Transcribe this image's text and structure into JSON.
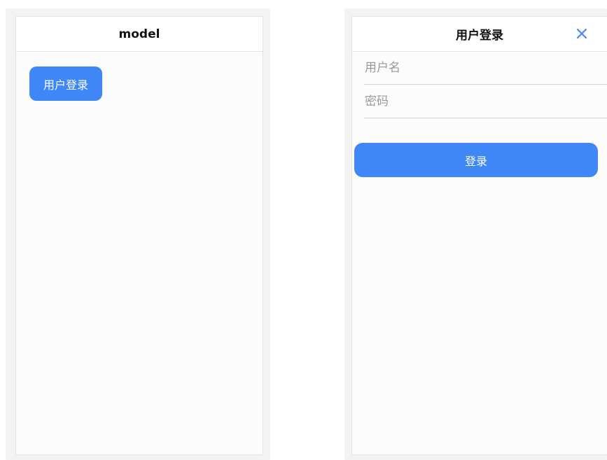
{
  "left_screen": {
    "nav_title": "model",
    "open_login_label": "用户登录"
  },
  "right_screen": {
    "nav_title": "用户登录",
    "close_icon": "close-icon",
    "username": {
      "value": "",
      "placeholder": "用户名"
    },
    "password": {
      "value": "",
      "placeholder": "密码"
    },
    "submit_label": "登录"
  },
  "colors": {
    "accent": "#3f86f7",
    "page_background": "#fcfcfc",
    "divider": "#e6e6e6"
  }
}
